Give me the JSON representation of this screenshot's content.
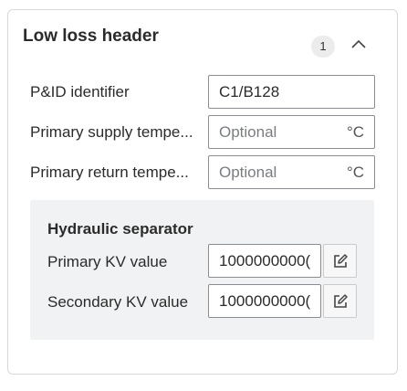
{
  "panel": {
    "title": "Low loss header",
    "badge_count": "1",
    "collapse_icon": "chevron-up-icon"
  },
  "fields": {
    "pid": {
      "label": "P&ID identifier",
      "value": "C1/B128"
    },
    "supply_temp": {
      "label": "Primary supply tempe...",
      "placeholder": "Optional",
      "unit": "°C"
    },
    "return_temp": {
      "label": "Primary return tempe...",
      "placeholder": "Optional",
      "unit": "°C"
    }
  },
  "hydraulic_separator": {
    "title": "Hydraulic separator",
    "primary_kv": {
      "label": "Primary KV value",
      "value": "1000000000(",
      "edit_icon": "edit-icon"
    },
    "secondary_kv": {
      "label": "Secondary KV value",
      "value": "1000000000(",
      "edit_icon": "edit-icon"
    }
  },
  "colors": {
    "border": "#8a8d91",
    "section_bg": "#f1f2f3",
    "badge_bg": "#ececec"
  }
}
